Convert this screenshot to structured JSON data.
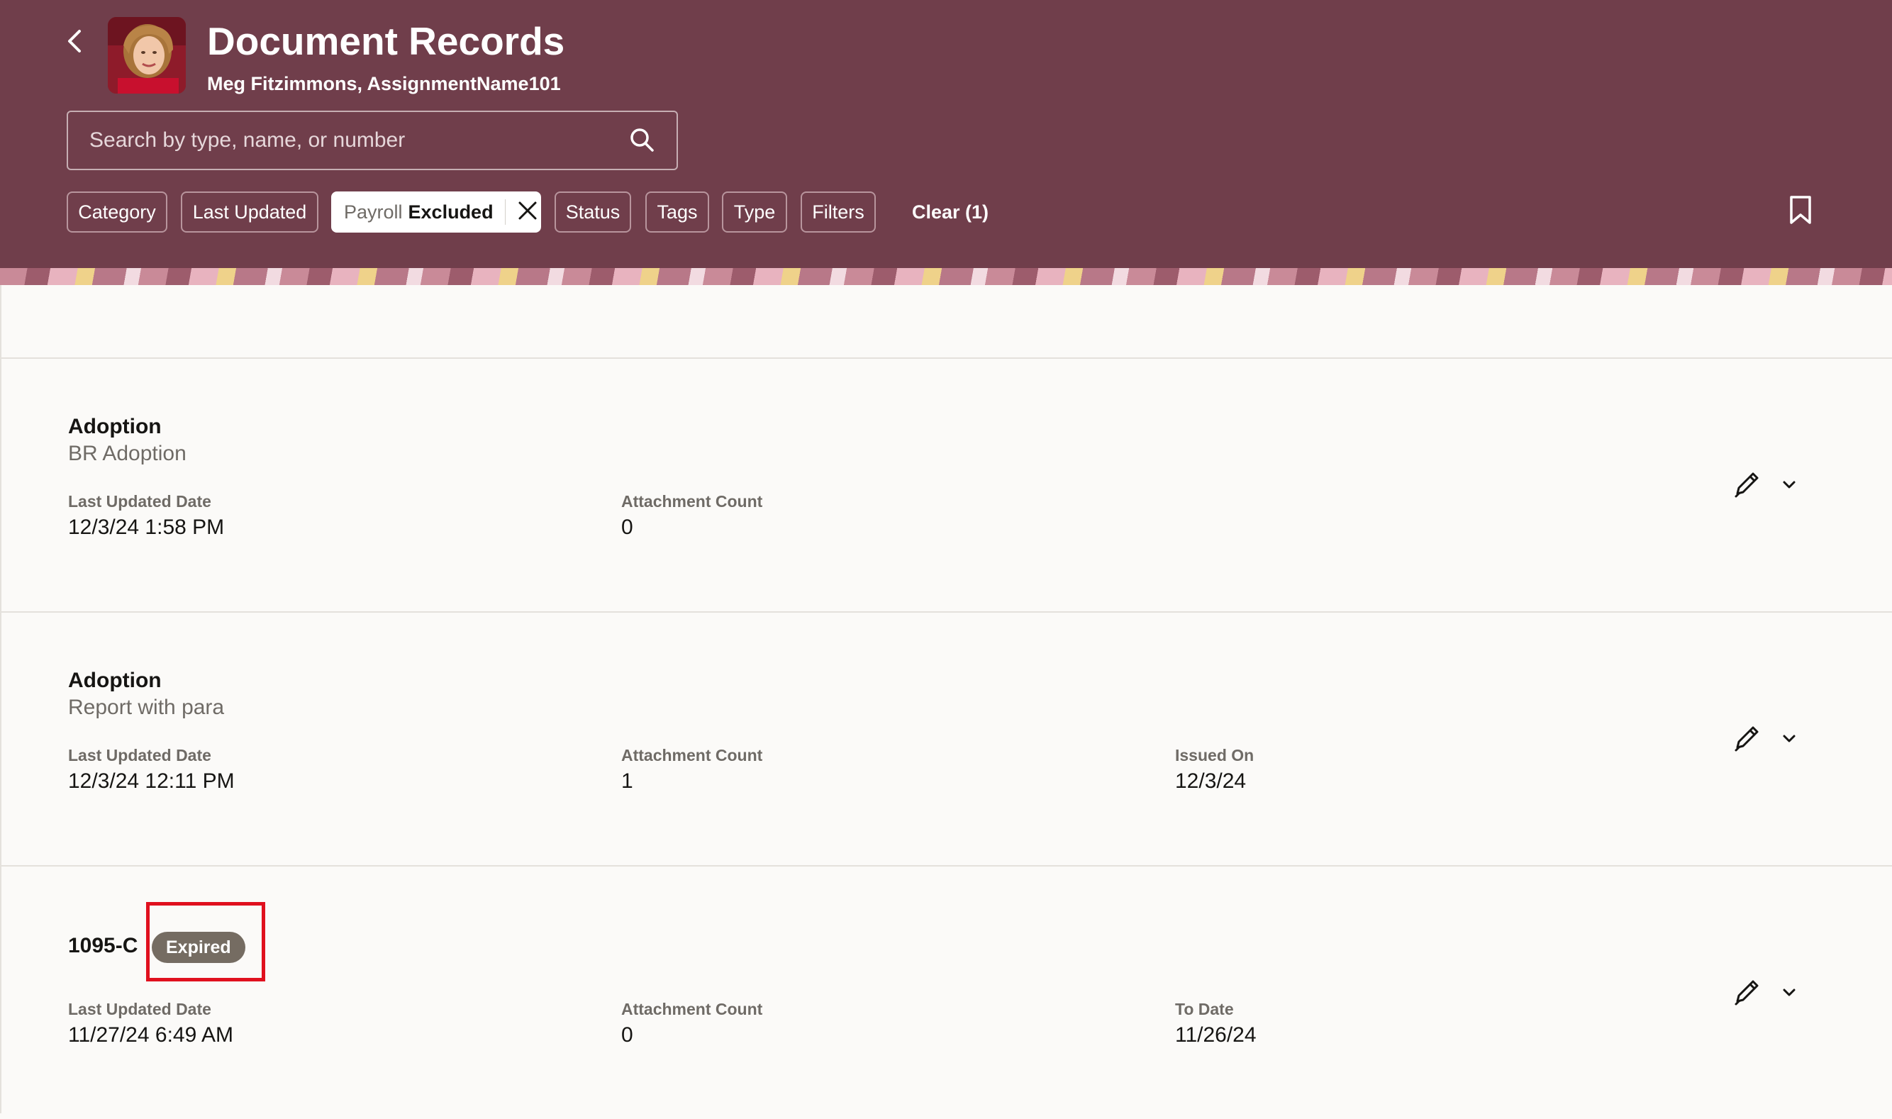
{
  "header": {
    "title": "Document Records",
    "subtitle": "Meg Fitzimmons, AssignmentName101",
    "back_icon": "chevron-left-icon",
    "search": {
      "placeholder": "Search by type, name, or number",
      "value": "",
      "icon": "search-icon"
    },
    "bookmark_icon": "bookmark-icon",
    "colors": {
      "header_bg": "#703e4b",
      "badge_bg": "#756c62",
      "highlight": "#e0101e"
    }
  },
  "filters": {
    "chips": [
      {
        "label": "Category"
      },
      {
        "label": "Last Updated"
      },
      {
        "label": "Status"
      },
      {
        "label": "Tags"
      },
      {
        "label": "Type"
      },
      {
        "label": "Filters"
      }
    ],
    "active_chip": {
      "key": "Payroll",
      "value": "Excluded",
      "close_icon": "close-icon"
    },
    "clear_label": "Clear (1)"
  },
  "records": [
    {
      "title": "Adoption",
      "subtitle": "BR Adoption",
      "badge": "",
      "fields": [
        {
          "label": "Last Updated Date",
          "value": "12/3/24 1:58 PM"
        },
        {
          "label": "Attachment Count",
          "value": "0"
        }
      ]
    },
    {
      "title": "Adoption",
      "subtitle": "Report with para",
      "badge": "",
      "fields": [
        {
          "label": "Last Updated Date",
          "value": "12/3/24 12:11 PM"
        },
        {
          "label": "Attachment Count",
          "value": "1"
        },
        {
          "label": "Issued On",
          "value": "12/3/24"
        }
      ]
    },
    {
      "title": "1095-C",
      "subtitle": "",
      "badge": "Expired",
      "fields": [
        {
          "label": "Last Updated Date",
          "value": "11/27/24 6:49 AM"
        },
        {
          "label": "Attachment Count",
          "value": "0"
        },
        {
          "label": "To Date",
          "value": "11/26/24"
        }
      ]
    }
  ]
}
